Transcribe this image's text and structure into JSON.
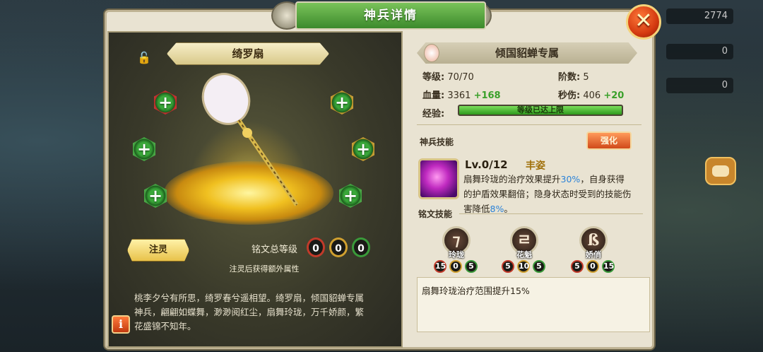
{
  "window": {
    "title": "神兵详情"
  },
  "hud": {
    "stat_1": "2774",
    "stat_2": "0",
    "stat_3": "0"
  },
  "weapon": {
    "name": "绮罗扇",
    "inject_button": "注灵",
    "rune_total_label": "铭文总等级",
    "rune_totals": [
      "0",
      "0",
      "0"
    ],
    "inject_hint": "注灵后获得额外属性",
    "description": "桃李夕兮有所思，绮罗春兮遥相望。绮罗扇，倾国貂蝉专属神兵，翩翩如蝶舞，渺渺阅红尘，扇舞玲珑，万千娇颜，繁花盛锦不知年。"
  },
  "owner": {
    "label": "倾国貂蝉专属"
  },
  "stats": {
    "level_label": "等级:",
    "level_value": "70/70",
    "rank_label": "阶数:",
    "rank_value": "5",
    "hp_label": "血量:",
    "hp_value": "3361",
    "hp_bonus": "+168",
    "dps_label": "秒伤:",
    "dps_value": "406",
    "dps_bonus": "+20",
    "exp_label": "经验:",
    "exp_text": "等级已达上限",
    "exp_fill": 1.0
  },
  "skill": {
    "section_label": "神兵技能",
    "enhance_button": "强化",
    "level": "Lv.0/12",
    "name": "丰姿",
    "desc_1": "扇舞玲珑的治疗效果提升",
    "desc_pct1": "30%",
    "desc_2": "，自身获得的护盾效果翻倍；隐身状态时受到的技能伤害降低",
    "desc_pct2": "8%",
    "desc_3": "。"
  },
  "runes": {
    "section_label": "铭文技能",
    "slots": [
      {
        "glyph": "⁊",
        "name": "玲珑",
        "counts": [
          "15",
          "0",
          "5"
        ]
      },
      {
        "glyph": "ㄹ",
        "name": "花魁",
        "counts": [
          "5",
          "10",
          "5"
        ]
      },
      {
        "glyph": "ß",
        "name": "娇俏",
        "counts": [
          "5",
          "0",
          "15"
        ]
      }
    ],
    "description": "扇舞玲珑治疗范围提升15%"
  },
  "icons": {
    "close": "close-x-icon",
    "lock": "unlock-icon",
    "info": "info-icon",
    "plus": "plus-icon",
    "chat": "chat-icon"
  },
  "colors": {
    "accent_green": "#3c8a2c",
    "bonus_green": "#3aa02a",
    "highlight_blue": "#2a82d8",
    "close_orange": "#d43a10"
  }
}
